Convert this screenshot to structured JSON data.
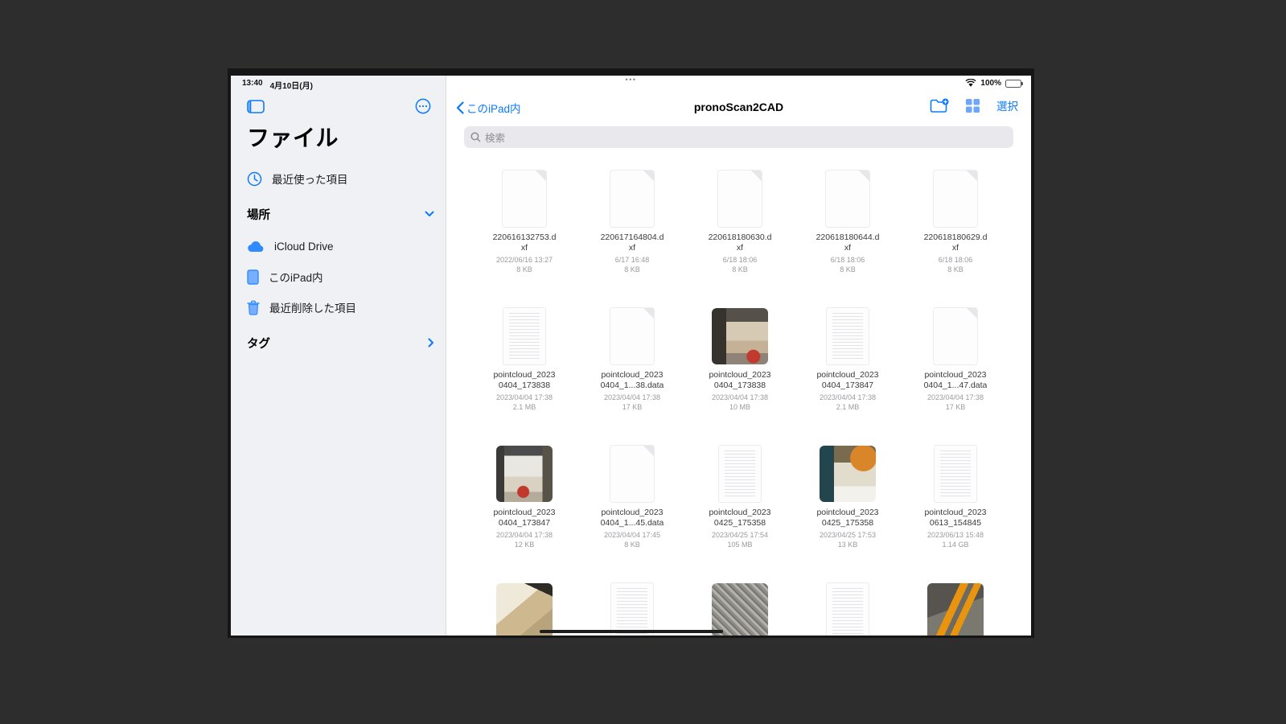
{
  "colors": {
    "accent": "#0a7aff",
    "page_bg": "#2d2d2d",
    "sidebar_bg": "#f0f1f5"
  },
  "status_bar": {
    "time": "13:40",
    "date": "4月10日(月)",
    "battery_percent": "100%",
    "multitask_dots": "•••"
  },
  "sidebar": {
    "app_title": "ファイル",
    "recents_label": "最近使った項目",
    "locations_header": "場所",
    "locations": [
      {
        "label": "iCloud Drive",
        "icon": "cloud-icon"
      },
      {
        "label": "このiPad内",
        "icon": "tablet-icon"
      },
      {
        "label": "最近削除した項目",
        "icon": "trash-icon"
      }
    ],
    "tags_header": "タグ"
  },
  "toolbar": {
    "back_label": "このiPad内",
    "title": "pronoScan2CAD",
    "select_label": "選択"
  },
  "search": {
    "placeholder": "検索"
  },
  "grid": {
    "files": [
      {
        "kind": "doc",
        "name_line1": "220616132753.d",
        "name_line2": "xf",
        "date": "2022/06/16 13:27",
        "size": "8 KB"
      },
      {
        "kind": "doc",
        "name_line1": "220617164804.d",
        "name_line2": "xf",
        "date": "6/17 16:48",
        "size": "8 KB"
      },
      {
        "kind": "doc",
        "name_line1": "220618180630.d",
        "name_line2": "xf",
        "date": "6/18 18:06",
        "size": "8 KB"
      },
      {
        "kind": "doc",
        "name_line1": "220618180644.d",
        "name_line2": "xf",
        "date": "6/18 18:06",
        "size": "8 KB"
      },
      {
        "kind": "doc",
        "name_line1": "220618180629.d",
        "name_line2": "xf",
        "date": "6/18 18:06",
        "size": "8 KB"
      },
      {
        "kind": "textpage",
        "name_line1": "pointcloud_2023",
        "name_line2": "0404_173838",
        "date": "2023/04/04 17:38",
        "size": "2.1 MB"
      },
      {
        "kind": "doc",
        "name_line1": "pointcloud_2023",
        "name_line2": "0404_1...38.data",
        "date": "2023/04/04 17:38",
        "size": "17 KB"
      },
      {
        "kind": "photo-indoor1",
        "name_line1": "pointcloud_2023",
        "name_line2": "0404_173838",
        "date": "2023/04/04 17:38",
        "size": "10 MB"
      },
      {
        "kind": "textpage",
        "name_line1": "pointcloud_2023",
        "name_line2": "0404_173847",
        "date": "2023/04/04 17:38",
        "size": "2.1 MB"
      },
      {
        "kind": "doc",
        "name_line1": "pointcloud_2023",
        "name_line2": "0404_1...47.data",
        "date": "2023/04/04 17:38",
        "size": "17 KB"
      },
      {
        "kind": "photo-indoor2",
        "name_line1": "pointcloud_2023",
        "name_line2": "0404_173847",
        "date": "2023/04/04 17:38",
        "size": "12 KB"
      },
      {
        "kind": "doc",
        "name_line1": "pointcloud_2023",
        "name_line2": "0404_1...45.data",
        "date": "2023/04/04 17:45",
        "size": "8 KB"
      },
      {
        "kind": "textpage",
        "name_line1": "pointcloud_2023",
        "name_line2": "0425_175358",
        "date": "2023/04/25 17:54",
        "size": "105 MB"
      },
      {
        "kind": "photo-workshop",
        "name_line1": "pointcloud_2023",
        "name_line2": "0425_175358",
        "date": "2023/04/25 17:53",
        "size": "13 KB"
      },
      {
        "kind": "textpage",
        "name_line1": "pointcloud_2023",
        "name_line2": "0613_154845",
        "date": "2023/06/13 15:48",
        "size": "1.14 GB"
      }
    ],
    "partial_row": [
      {
        "kind": "photo-corner"
      },
      {
        "kind": "textpage"
      },
      {
        "kind": "photo-gravel"
      },
      {
        "kind": "textpage"
      },
      {
        "kind": "photo-asphalt"
      }
    ]
  }
}
